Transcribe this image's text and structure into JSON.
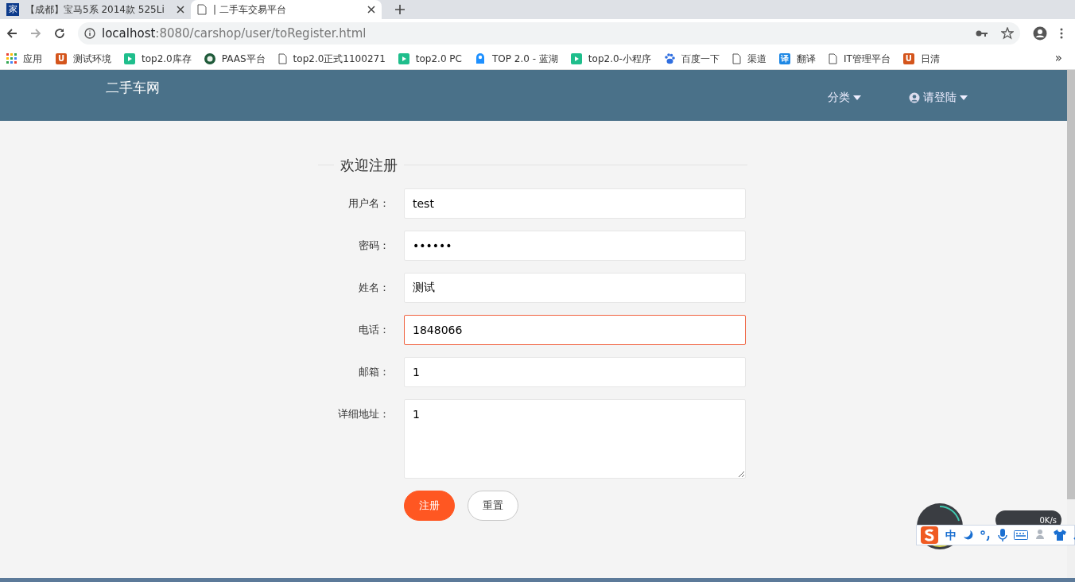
{
  "browser": {
    "tabs": [
      {
        "favicon": "家",
        "title": "【成都】宝马5系 2014款 525Li",
        "selected": false
      },
      {
        "title": "| 二手车交易平台",
        "selected": true
      }
    ],
    "address": {
      "host": "localhost",
      "path": ":8080/carshop/user/toRegister.html"
    },
    "bookmarks": [
      {
        "kind": "apps",
        "label": "应用"
      },
      {
        "kind": "letter",
        "icon_text": "U",
        "label": "测试环境"
      },
      {
        "kind": "play",
        "label": "top2.0库存"
      },
      {
        "kind": "round",
        "label": "PAAS平台"
      },
      {
        "kind": "page",
        "label": "top2.0正式1100271"
      },
      {
        "kind": "play",
        "label": "top2.0 PC"
      },
      {
        "kind": "creature",
        "label": "TOP 2.0 - 蓝湖"
      },
      {
        "kind": "play",
        "label": "top2.0-小程序"
      },
      {
        "kind": "paw",
        "label": "百度一下"
      },
      {
        "kind": "page",
        "label": "渠道"
      },
      {
        "kind": "letterblue",
        "icon_text": "译",
        "label": "翻译"
      },
      {
        "kind": "page",
        "label": "IT管理平台"
      },
      {
        "kind": "letter",
        "icon_text": "U",
        "label": "日清"
      }
    ],
    "overflow": "»"
  },
  "navbar": {
    "brand": "二手车网",
    "menus": [
      {
        "label": "分类",
        "user_icon": false
      },
      {
        "label": "请登陆",
        "user_icon": true
      }
    ]
  },
  "form": {
    "title": "欢迎注册",
    "fields": [
      {
        "label": "用户名：",
        "kind": "text",
        "value": "test",
        "focused": false
      },
      {
        "label": "密码：",
        "kind": "text",
        "value": "••••••",
        "focused": false
      },
      {
        "label": "姓名：",
        "kind": "text",
        "value": "测试",
        "focused": false
      },
      {
        "label": "电话：",
        "kind": "text",
        "value": "1848066",
        "focused": true
      },
      {
        "label": "邮箱：",
        "kind": "text",
        "value": "1",
        "focused": false
      },
      {
        "label": "详细地址：",
        "kind": "textarea",
        "value": "1",
        "focused": false
      }
    ],
    "buttons": [
      {
        "label": "注册",
        "kind": "primary"
      },
      {
        "label": "重置",
        "kind": "secondary"
      }
    ]
  },
  "ime": {
    "mode": "中",
    "speed": "0K/s"
  }
}
